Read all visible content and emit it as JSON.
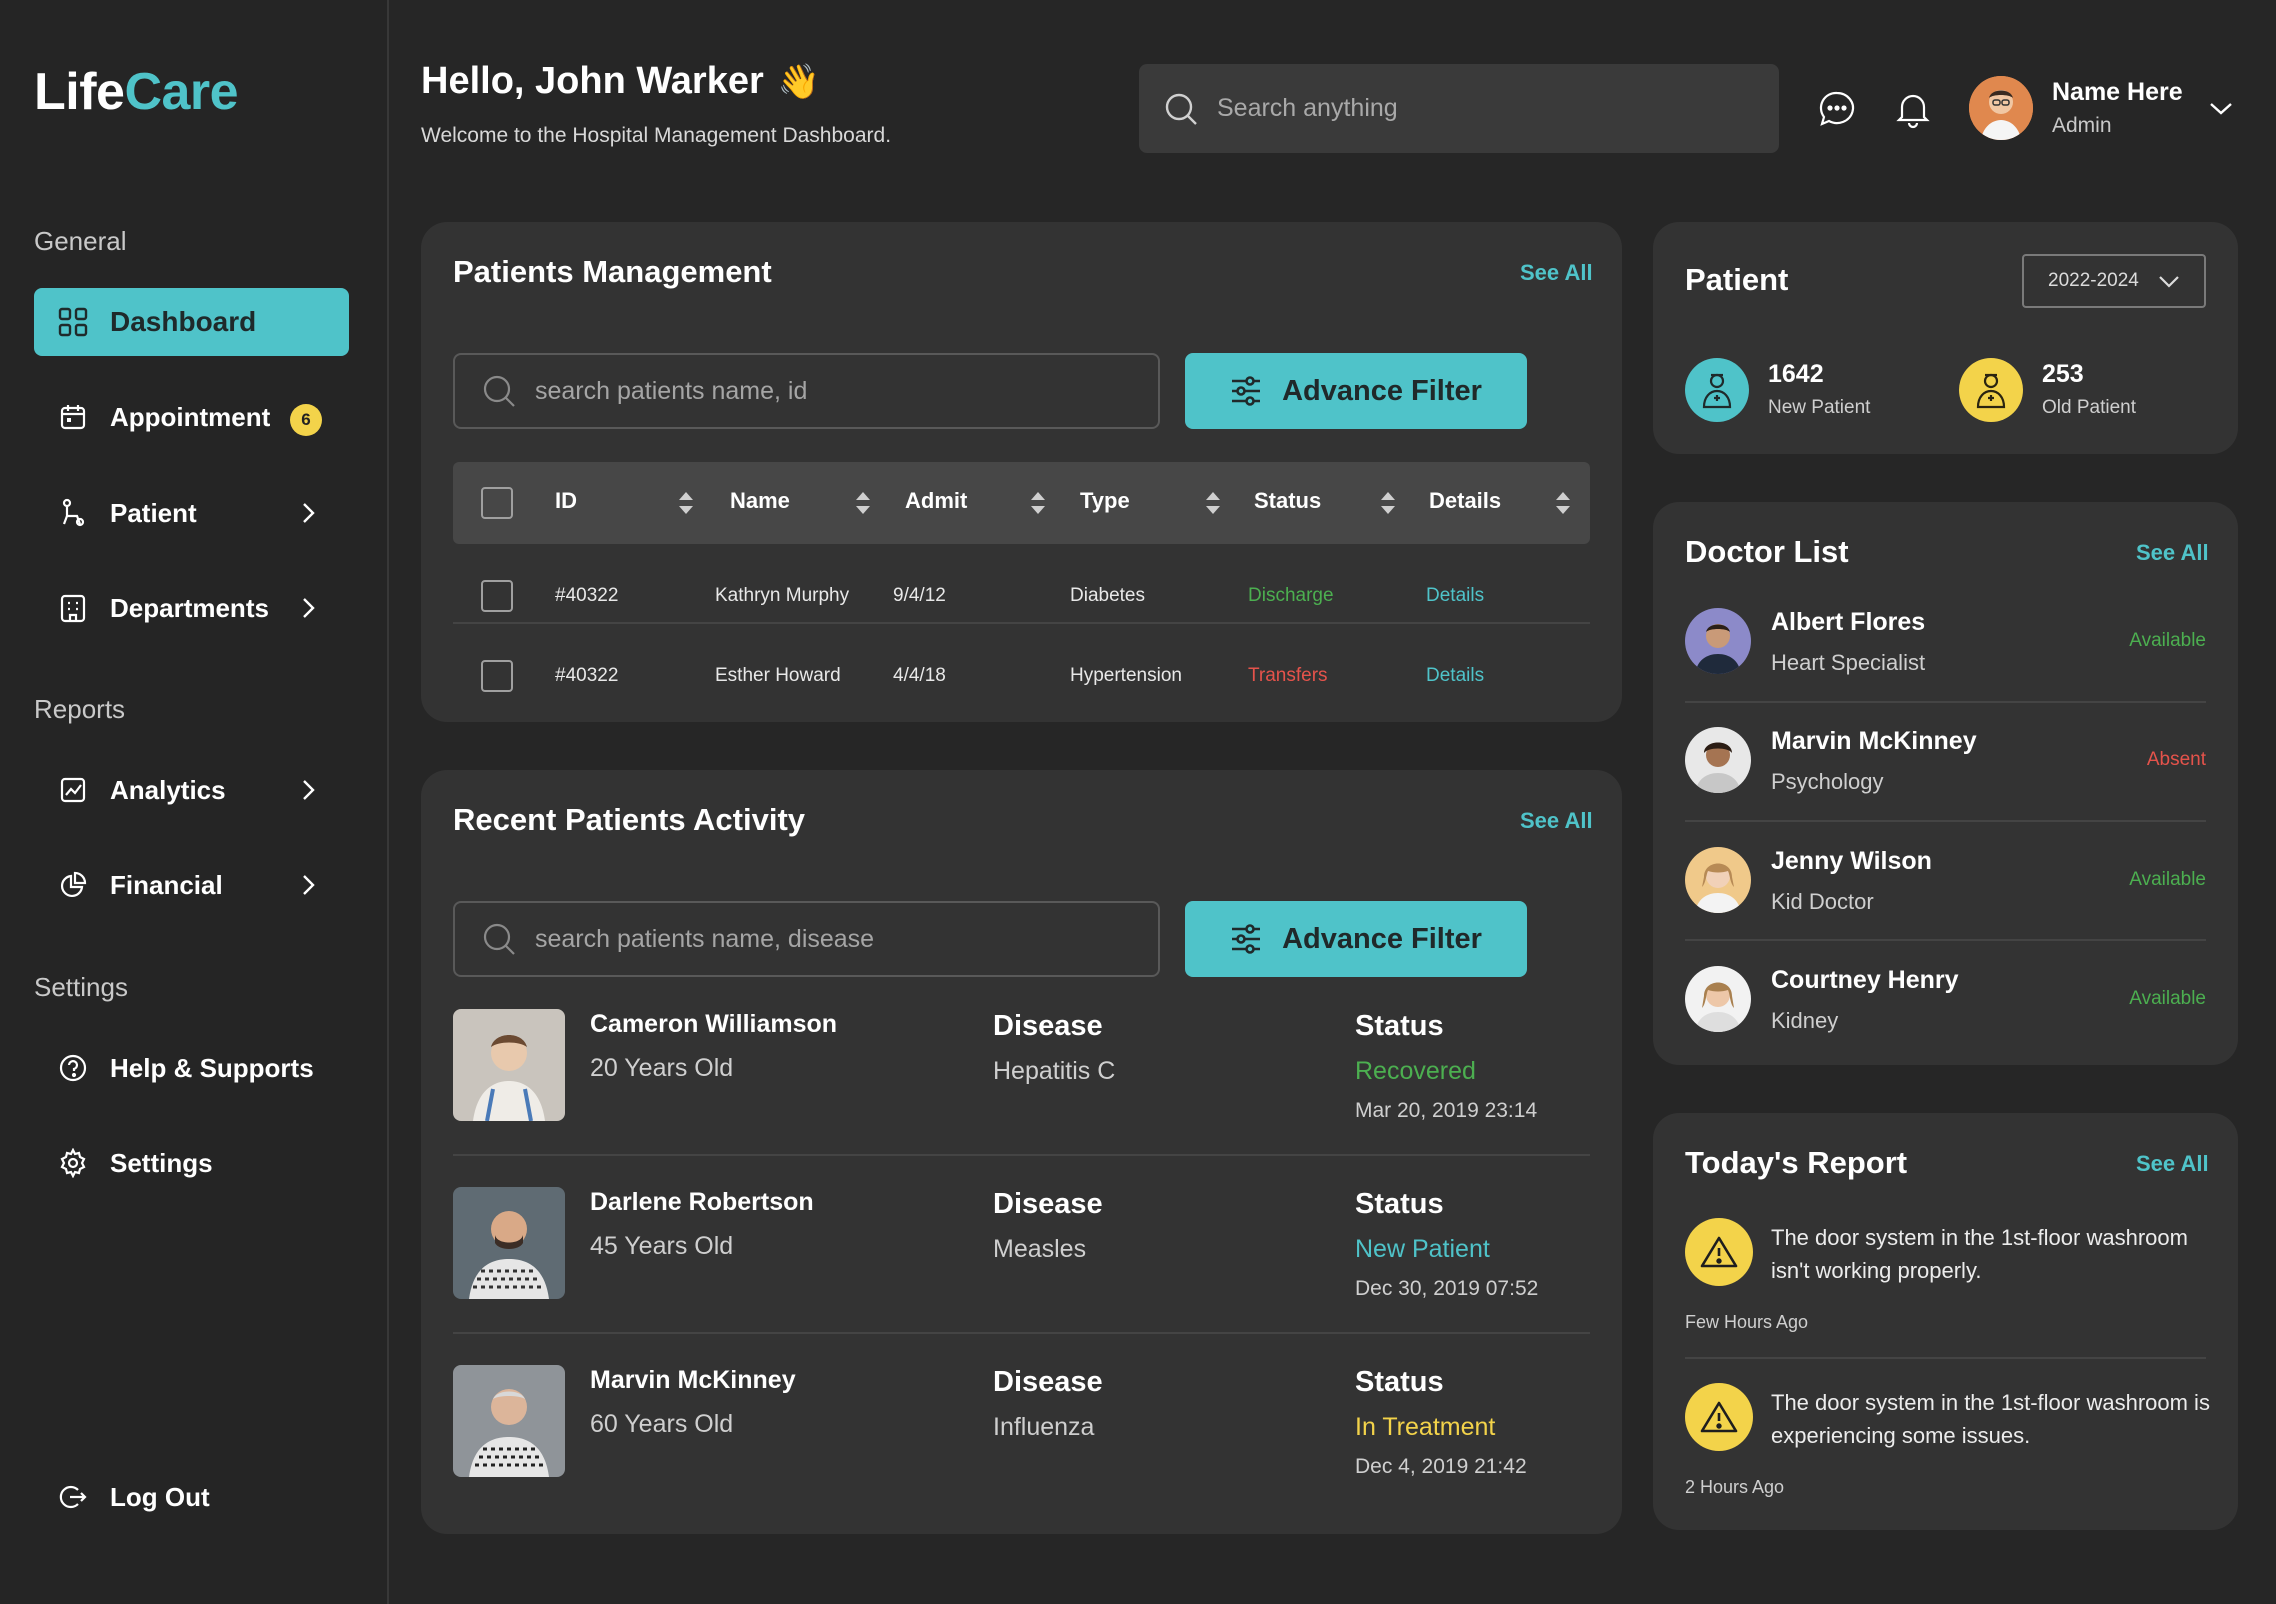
{
  "app": {
    "logo_part1": "Life",
    "logo_part2": "Care",
    "accent_color": "#4fc3c9",
    "warning_color": "#f3d34a",
    "success_color": "#4caf50",
    "danger_color": "#e5534b"
  },
  "sidebar": {
    "sections": [
      "General",
      "Reports",
      "Settings"
    ],
    "items": [
      {
        "label": "Dashboard",
        "icon": "grid-icon",
        "active": true
      },
      {
        "label": "Appointment",
        "icon": "calendar-icon",
        "badge": "6"
      },
      {
        "label": "Patient",
        "icon": "patient-icon"
      },
      {
        "label": "Departments",
        "icon": "building-icon"
      },
      {
        "label": "Analytics",
        "icon": "chart-icon"
      },
      {
        "label": "Financial",
        "icon": "pie-icon"
      },
      {
        "label": "Help & Supports",
        "icon": "help-icon"
      },
      {
        "label": "Settings",
        "icon": "gear-icon"
      }
    ],
    "logout": "Log Out"
  },
  "header": {
    "greeting": "Hello, John Warker",
    "wave": "👋",
    "subtitle": "Welcome to the Hospital Management Dashboard.",
    "search_placeholder": "Search anything",
    "user_name": "Name Here",
    "user_role": "Admin"
  },
  "patients_mgmt": {
    "title": "Patients Management",
    "see_all": "See All",
    "search_placeholder": "search patients name, id",
    "filter_label": "Advance Filter",
    "columns": [
      "ID",
      "Name",
      "Admit",
      "Type",
      "Status",
      "Details"
    ],
    "rows": [
      {
        "id": "#40322",
        "name": "Kathryn Murphy",
        "admit": "9/4/12",
        "type": "Diabetes",
        "status": "Discharge",
        "details": "Details"
      },
      {
        "id": "#40322",
        "name": "Esther Howard",
        "admit": "4/4/18",
        "type": "Hypertension",
        "status": "Transfers",
        "details": "Details"
      }
    ]
  },
  "recent": {
    "title": "Recent Patients Activity",
    "see_all": "See All",
    "search_placeholder": "search patients name, disease",
    "filter_label": "Advance Filter",
    "disease_header": "Disease",
    "status_header": "Status",
    "items": [
      {
        "name": "Cameron Williamson",
        "age": "20 Years Old",
        "disease": "Hepatitis C",
        "status": "Recovered",
        "status_color": "#4caf50",
        "date": "Mar 20, 2019 23:14"
      },
      {
        "name": "Darlene Robertson",
        "age": "45 Years Old",
        "disease": "Measles",
        "status": "New Patient",
        "status_color": "#4fc3c9",
        "date": "Dec 30, 2019 07:52"
      },
      {
        "name": "Marvin McKinney",
        "age": "60 Years Old",
        "disease": "Influenza",
        "status": "In Treatment",
        "status_color": "#f3d34a",
        "date": "Dec 4, 2019 21:42"
      }
    ]
  },
  "patient_card": {
    "title": "Patient",
    "range": "2022-2024",
    "new_count": "1642",
    "new_label": "New Patient",
    "old_count": "253",
    "old_label": "Old Patient"
  },
  "doctors": {
    "title": "Doctor List",
    "see_all": "See All",
    "items": [
      {
        "name": "Albert Flores",
        "spec": "Heart Specialist",
        "status": "Available"
      },
      {
        "name": "Marvin McKinney",
        "spec": "Psychology",
        "status": "Absent"
      },
      {
        "name": "Jenny Wilson",
        "spec": "Kid Doctor",
        "status": "Available"
      },
      {
        "name": "Courtney Henry",
        "spec": "Kidney",
        "status": "Available"
      }
    ]
  },
  "report": {
    "title": "Today's Report",
    "see_all": "See All",
    "items": [
      {
        "text": "The door system in the 1st-floor washroom isn't working properly.",
        "time": "Few Hours Ago"
      },
      {
        "text": "The door system in the 1st-floor washroom is experiencing some issues.",
        "time": "2 Hours Ago"
      }
    ]
  }
}
